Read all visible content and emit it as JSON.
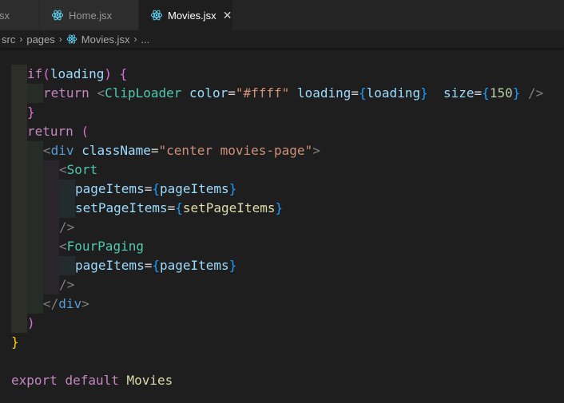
{
  "tabs": [
    {
      "label": "sx",
      "icon": "react-icon",
      "active": false
    },
    {
      "label": "Home.jsx",
      "icon": "react-icon",
      "active": false
    },
    {
      "label": "Movies.jsx",
      "icon": "react-icon",
      "active": true,
      "close": "✕"
    }
  ],
  "breadcrumb": {
    "items": [
      "src",
      "pages",
      "Movies.jsx",
      "..."
    ],
    "separator": "›"
  },
  "colors": {
    "editor_bg": "#1e1e1e",
    "tab_bar_bg": "#252526",
    "react_icon": "#61dafb",
    "keyword": "#c586c0",
    "keyword_blue": "#569cd6",
    "component": "#4ec9b0",
    "attribute": "#9cdcfe",
    "string": "#ce9178",
    "number": "#b5cea8",
    "identifier_yellow": "#dcdcaa"
  },
  "code": {
    "line1": {
      "kw": "if",
      "p1": "(",
      "var": "loading",
      "p2": ")",
      "sp": " ",
      "brace": "{"
    },
    "line2": {
      "kw": "return",
      "lt": "<",
      "tag": "ClipLoader",
      "attr1": "color",
      "eq1": "=",
      "str1": "\"#ffff\"",
      "attr2": "loading",
      "eq2": "=",
      "ob2": "{",
      "val2": "loading",
      "cb2": "}",
      "attr3": "size",
      "eq3": "=",
      "ob3": "{",
      "num3": "150",
      "cb3": "}",
      "close": "/>"
    },
    "line3": {
      "brace": "}"
    },
    "line4": {
      "kw": "return",
      "paren": "("
    },
    "line5": {
      "lt": "<",
      "tag": "div",
      "attr": "className",
      "eq": "=",
      "str": "\"center movies-page\"",
      "gt": ">"
    },
    "line6": {
      "lt": "<",
      "tag": "Sort"
    },
    "line7": {
      "attr": "pageItems",
      "eq": "=",
      "ob": "{",
      "val": "pageItems",
      "cb": "}"
    },
    "line8": {
      "attr": "setPageItems",
      "eq": "=",
      "ob": "{",
      "val": "setPageItems",
      "cb": "}"
    },
    "line9": {
      "close": "/>"
    },
    "line10": {
      "lt": "<",
      "tag": "FourPaging"
    },
    "line11": {
      "attr": "pageItems",
      "eq": "=",
      "ob": "{",
      "val": "pageItems",
      "cb": "}"
    },
    "line12": {
      "close": "/>"
    },
    "line13": {
      "lt": "</",
      "tag": "div",
      "gt": ">"
    },
    "line14": {
      "paren": ")"
    },
    "line15": {
      "brace": "}"
    },
    "line17": {
      "kw1": "export",
      "kw2": "default",
      "name": "Movies"
    }
  }
}
